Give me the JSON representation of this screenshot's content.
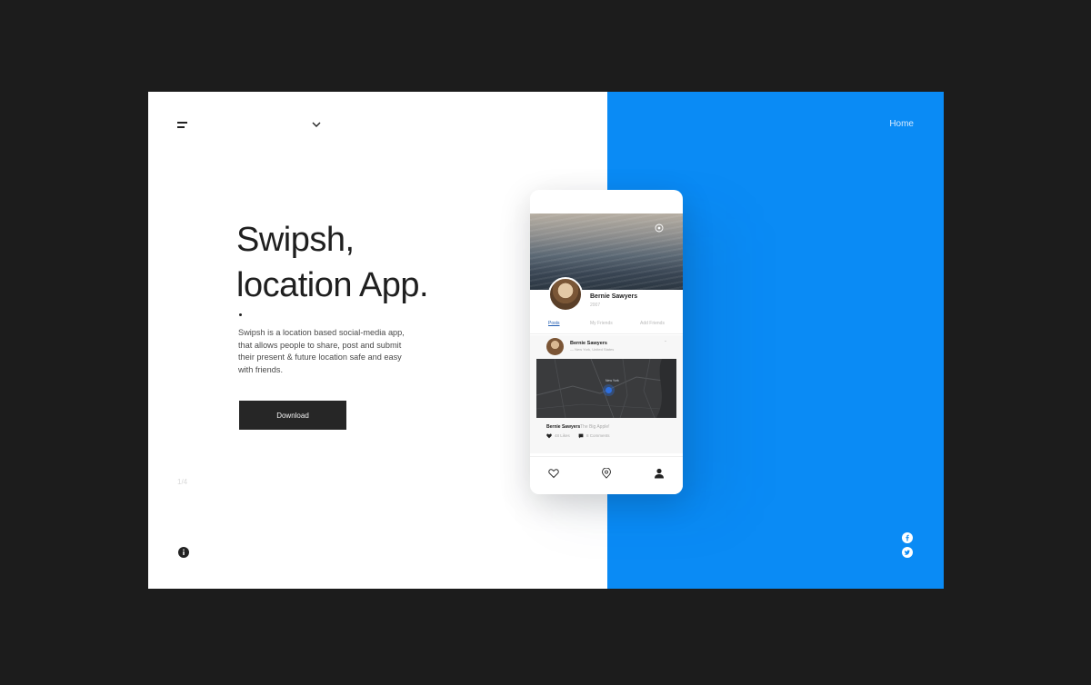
{
  "header": {
    "language_text": "",
    "home_link": "Home"
  },
  "hero": {
    "title_line1": "Swipsh,",
    "title_line2": "location App.",
    "description": "Swipsh is a location based social-media app, that allows people to share, post and submit their present & future location safe and easy with friends.",
    "download_button": "Download"
  },
  "side": {
    "counter": "1/4"
  },
  "social": {
    "icons": [
      "facebook-icon",
      "twitter-icon"
    ]
  },
  "phone": {
    "profile": {
      "name": "Bernie Sawyers",
      "subtitle": "2007"
    },
    "tabs": [
      "Posts",
      "My Friends",
      "Add Friends"
    ],
    "post": {
      "author": "Bernie Sawyers",
      "location": "— New York, United States",
      "map_label": "New York",
      "caption_author": "Bernie Sawyers",
      "caption_text": "The Big Apple!",
      "likes": "48 Likes",
      "comments": "8 Comments"
    },
    "bottom_nav": [
      "heart-icon",
      "map-icon",
      "profile-icon"
    ]
  },
  "colors": {
    "accent_blue": "#0a8bf5",
    "button_dark": "#262626",
    "page_background": "#1c1c1c"
  }
}
